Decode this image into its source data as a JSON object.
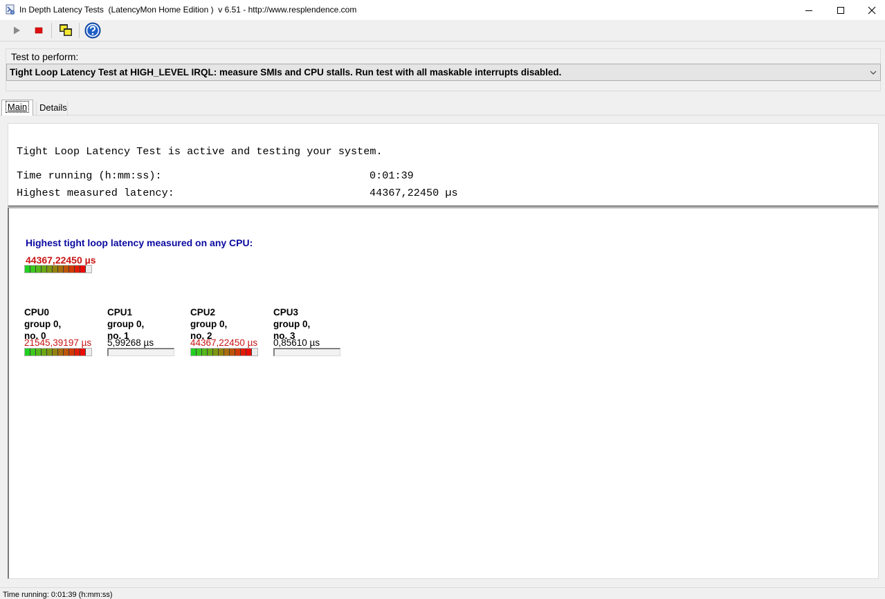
{
  "window": {
    "title": "In Depth Latency Tests  (LatencyMon Home Edition )  v 6.51 - http://www.resplendence.com",
    "icon": "latencymon-app-icon",
    "controls": [
      "minimize-icon",
      "maximize-icon",
      "close-icon"
    ]
  },
  "toolbar": {
    "buttons": [
      {
        "name": "play-button",
        "icon": "play-icon"
      },
      {
        "name": "stop-button",
        "icon": "stop-icon"
      },
      {
        "name": "windows-button",
        "icon": "cascade-windows-icon"
      },
      {
        "name": "help-button",
        "icon": "help-icon"
      }
    ]
  },
  "test": {
    "label": "Test to perform:",
    "selected": "Tight Loop Latency Test at HIGH_LEVEL IRQL:  measure SMIs and CPU stalls. Run test with all maskable interrupts disabled."
  },
  "tabs": [
    {
      "label": "Main",
      "active": true
    },
    {
      "label": "Details",
      "active": false
    }
  ],
  "info": {
    "status": "Tight Loop Latency Test is active and testing your system.",
    "time_label": "Time running (h:mm:ss):",
    "time_value": "0:01:39",
    "latency_label": "Highest measured latency:",
    "latency_value": "44367,22450 µs"
  },
  "highest": {
    "heading": "Highest tight loop latency measured on any CPU:",
    "value": "44367,22450 µs",
    "level": 1.0
  },
  "cpus": [
    {
      "name": "CPU0",
      "group": "group 0,",
      "no": "no. 0",
      "value": "21545,39197 µs",
      "alarm": true,
      "level": 1.0
    },
    {
      "name": "CPU1",
      "group": "group 0,",
      "no": "no. 1",
      "value": "5,99268 µs",
      "alarm": false,
      "level": 0.0
    },
    {
      "name": "CPU2",
      "group": "group 0,",
      "no": "no. 2",
      "value": "44367,22450 µs",
      "alarm": true,
      "level": 1.0
    },
    {
      "name": "CPU3",
      "group": "group 0,",
      "no": "no. 3",
      "value": "0,85610 µs",
      "alarm": false,
      "level": 0.0
    }
  ],
  "colors": {
    "heading_blue": "#0a0aa0",
    "alarm_red": "#c81414",
    "meter_segments": [
      "#22d022",
      "#3cc81e",
      "#56b81a",
      "#6aa816",
      "#7e9612",
      "#93820e",
      "#a86c0c",
      "#bd5408",
      "#d03a06",
      "#e01c04",
      "#ee0a02"
    ]
  },
  "statusbar": {
    "text": "Time running: 0:01:39  (h:mm:ss)"
  }
}
